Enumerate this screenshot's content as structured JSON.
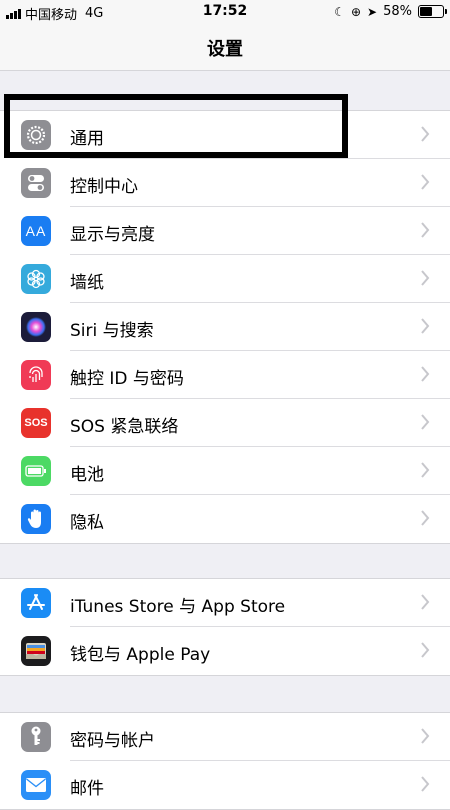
{
  "status_bar": {
    "carrier": "中国移动",
    "network": "4G",
    "time": "17:52",
    "battery_percent": "58%",
    "battery_level": 0.58
  },
  "nav": {
    "title": "设置"
  },
  "groups": [
    {
      "items": [
        {
          "label": "通用",
          "icon": "gear-icon",
          "color": "#8e8e93"
        },
        {
          "label": "控制中心",
          "icon": "toggle-switches-icon",
          "color": "#8e8e93"
        },
        {
          "label": "显示与亮度",
          "icon": "text-size-icon",
          "color": "#1a7df2",
          "icon_text": "AA"
        },
        {
          "label": "墙纸",
          "icon": "flower-icon",
          "color": "#35aadc"
        },
        {
          "label": "Siri 与搜索",
          "icon": "siri-icon",
          "color": "#1c1c3a"
        },
        {
          "label": "触控 ID 与密码",
          "icon": "fingerprint-icon",
          "color": "#f03a56"
        },
        {
          "label": "SOS 紧急联络",
          "icon": "sos-icon",
          "color": "#e8322c",
          "icon_text": "SOS"
        },
        {
          "label": "电池",
          "icon": "battery-icon",
          "color": "#4cd964"
        },
        {
          "label": "隐私",
          "icon": "hand-icon",
          "color": "#1a7df2"
        }
      ]
    },
    {
      "items": [
        {
          "label": "iTunes Store 与 App Store",
          "icon": "app-store-icon",
          "color": "#1a8cf5"
        },
        {
          "label": "钱包与 Apple Pay",
          "icon": "wallet-icon",
          "color": "#1c1c1e"
        }
      ]
    },
    {
      "items": [
        {
          "label": "密码与帐户",
          "icon": "key-icon",
          "color": "#8e8e93"
        },
        {
          "label": "邮件",
          "icon": "mail-icon",
          "color": "#2a8ff7"
        }
      ]
    }
  ]
}
